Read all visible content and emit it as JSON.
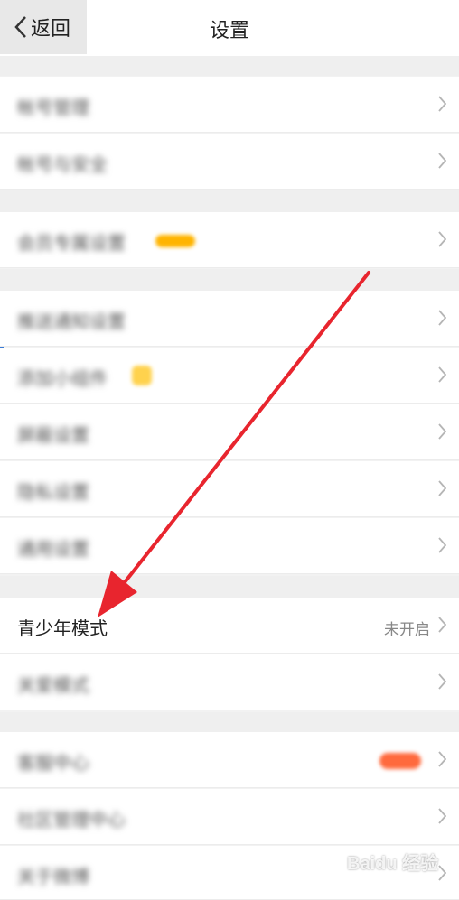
{
  "header": {
    "back_label": "返回",
    "title": "设置"
  },
  "rows": [
    {
      "label": "帐号管理"
    },
    {
      "label": "帐号与安全"
    },
    {
      "label": "会员专属设置"
    },
    {
      "label": "推送通知设置"
    },
    {
      "label": "添加小组件"
    },
    {
      "label": "屏蔽设置"
    },
    {
      "label": "隐私设置"
    },
    {
      "label": "通用设置"
    },
    {
      "label": "青少年模式",
      "value": "未开启"
    },
    {
      "label": "关爱模式"
    },
    {
      "label": "客服中心"
    },
    {
      "label": "社区管理中心"
    },
    {
      "label": "关于微博"
    }
  ],
  "watermark": "Baidu 经验",
  "colors": {
    "arrow": "#e8252e",
    "badge_orange": "#ff6a3d",
    "vip_badge": "#ffb400",
    "widget_badge": "#ffd24d"
  },
  "icons": {
    "back": "chevron-left-icon",
    "row": "chevron-right-icon"
  }
}
